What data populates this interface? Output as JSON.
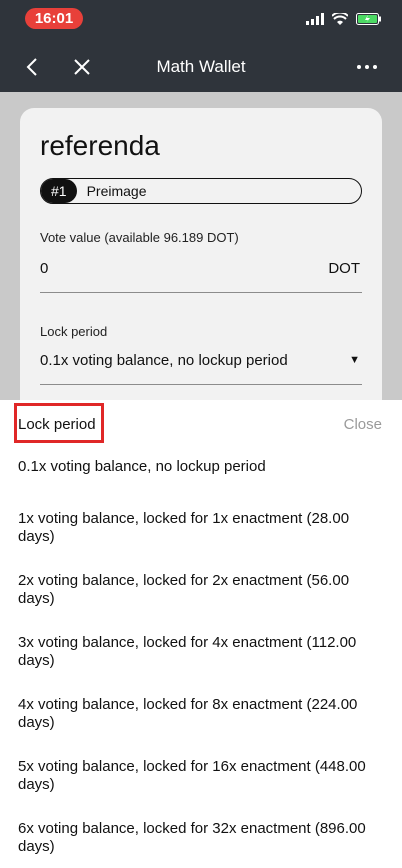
{
  "status_bar": {
    "time": "16:01"
  },
  "nav": {
    "title": "Math Wallet"
  },
  "card": {
    "title": "referenda",
    "tag_number": "#1",
    "tag_label": "Preimage",
    "vote_label": "Vote value (available 96.189 DOT)",
    "vote_value": "0",
    "vote_unit": "DOT",
    "lock_label": "Lock period",
    "lock_value": "0.1x voting balance, no lockup period"
  },
  "sheet": {
    "title": "Lock period",
    "close_label": "Close",
    "options": [
      "0.1x voting balance, no lockup period",
      "1x voting balance, locked for 1x enactment (28.00 days)",
      "2x voting balance, locked for 2x enactment (56.00 days)",
      "3x voting balance, locked for 4x enactment (112.00 days)",
      "4x voting balance, locked for 8x enactment (224.00 days)",
      "5x voting balance, locked for 16x enactment (448.00 days)",
      "6x voting balance, locked for 32x enactment (896.00 days)"
    ]
  },
  "colors": {
    "nav_bg": "#2f343b",
    "time_pill": "#e8403a",
    "vote_button": "#3aa157",
    "cancel_button": "#c7383c",
    "highlight_border": "#e02727"
  }
}
